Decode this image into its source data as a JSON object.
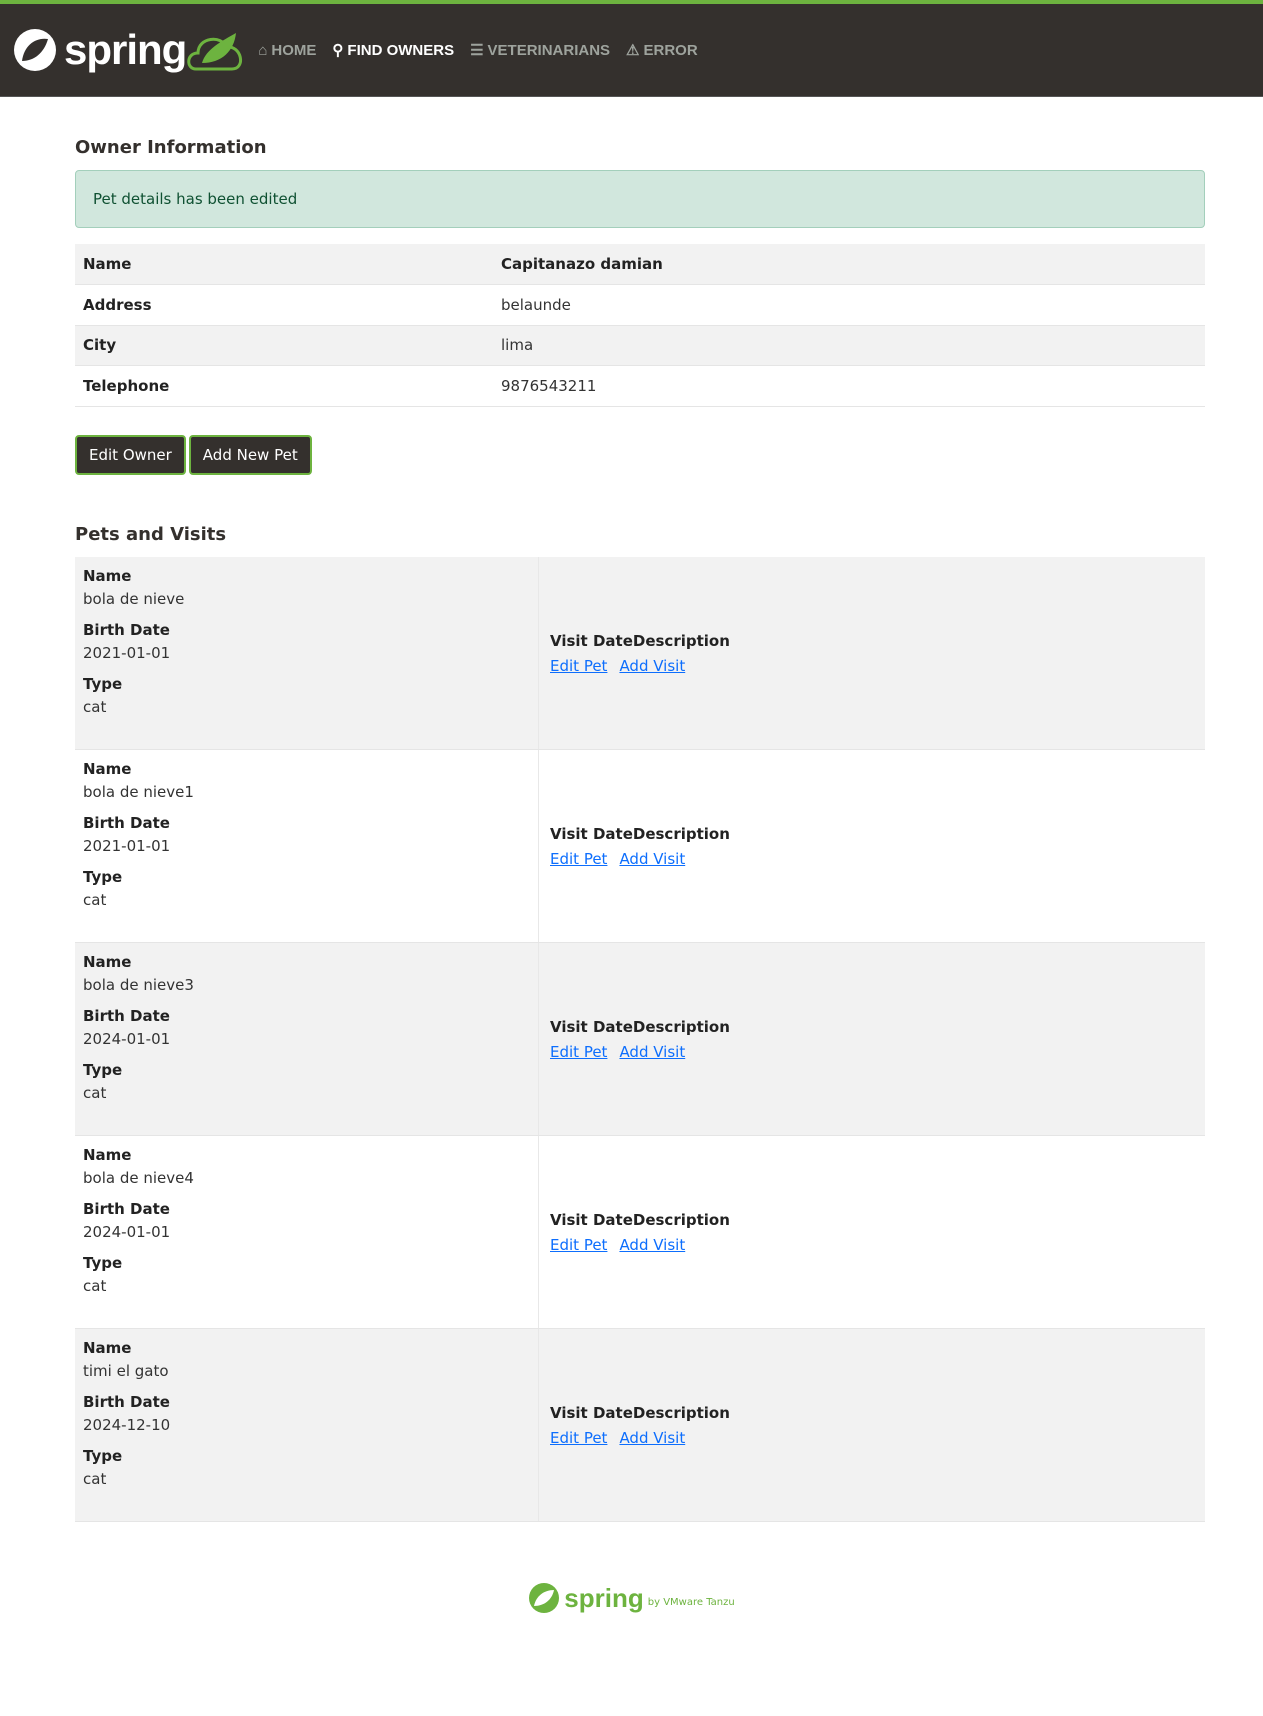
{
  "nav": {
    "logo_text": "spring",
    "items": [
      {
        "label": "HOME",
        "icon": "home-icon"
      },
      {
        "label": "FIND OWNERS",
        "icon": "search-icon",
        "active": true
      },
      {
        "label": "VETERINARIANS",
        "icon": "list-icon"
      },
      {
        "label": "ERROR",
        "icon": "warning-icon"
      }
    ]
  },
  "owner": {
    "title": "Owner Information",
    "alert": "Pet details has been edited",
    "rows": [
      {
        "label": "Name",
        "value": "Capitanazo damian"
      },
      {
        "label": "Address",
        "value": "belaunde"
      },
      {
        "label": "City",
        "value": "lima"
      },
      {
        "label": "Telephone",
        "value": "9876543211"
      }
    ],
    "edit_button": "Edit Owner",
    "add_pet_button": "Add New Pet"
  },
  "pets": {
    "title": "Pets and Visits",
    "name_label": "Name",
    "birth_label": "Birth Date",
    "type_label": "Type",
    "visit_date_header": "Visit Date",
    "description_header": "Description",
    "edit_pet": "Edit Pet",
    "add_visit": "Add Visit",
    "items": [
      {
        "name": "bola de nieve",
        "birth": "2021-01-01",
        "type": "cat"
      },
      {
        "name": "bola de nieve1",
        "birth": "2021-01-01",
        "type": "cat"
      },
      {
        "name": "bola de nieve3",
        "birth": "2024-01-01",
        "type": "cat"
      },
      {
        "name": "bola de nieve4",
        "birth": "2024-01-01",
        "type": "cat"
      },
      {
        "name": "timi el gato",
        "birth": "2024-12-10",
        "type": "cat"
      }
    ]
  },
  "footer": {
    "logo_text": "spring",
    "by": "by VMware Tanzu"
  },
  "colors": {
    "brand": "#6db33f",
    "nav_bg": "#34302d"
  }
}
